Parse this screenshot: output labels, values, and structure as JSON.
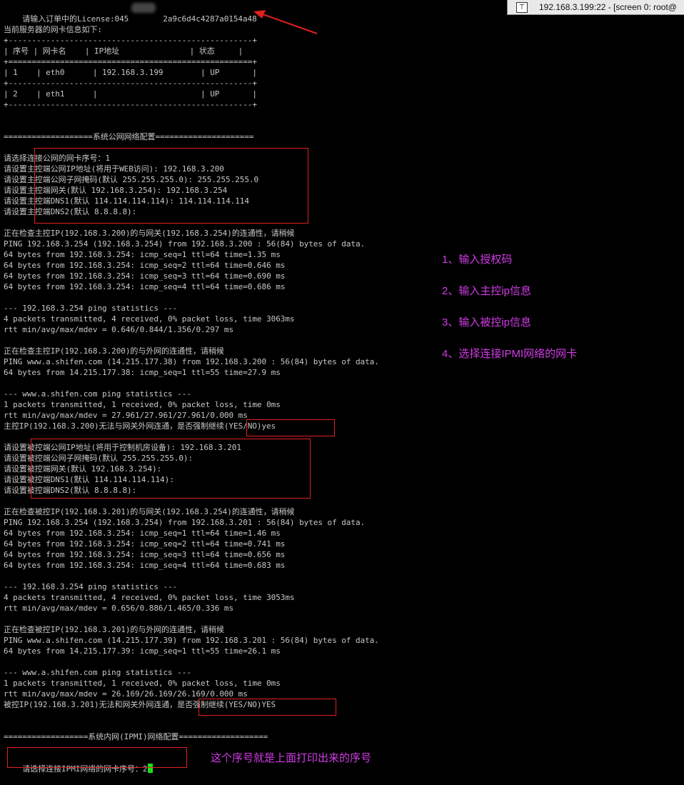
{
  "window": {
    "title": "192.168.3.199:22 - [screen 0: root@"
  },
  "terminal": {
    "license_prefix": "请输入订单中的License:045",
    "license_suffix": "2a9c6d4c4287a0154a48",
    "lines": [
      "当前服务器的网卡信息如下:",
      "+----------------------------------------------------+",
      "| 序号 | 网卡名    | IP地址               | 状态     |",
      "+====================================================+",
      "| 1    | eth0      | 192.168.3.199        | UP       |",
      "+----------------------------------------------------+",
      "| 2    | eth1      |                      | UP       |",
      "+----------------------------------------------------+",
      "===================系统公网网络配置=====================",
      "请选择连接公网的网卡序号：1",
      "请设置主控端公网IP地址(将用于WEB访问): 192.168.3.200",
      "请设置主控端公网子网掩码(默认 255.255.255.0): 255.255.255.0",
      "请设置主控端网关(默认 192.168.3.254): 192.168.3.254",
      "请设置主控端DNS1(默认 114.114.114.114): 114.114.114.114",
      "请设置主控端DNS2(默认 8.8.8.8):",
      "正在检查主控IP(192.168.3.200)的与网关(192.168.3.254)的连通性，请稍候",
      "PING 192.168.3.254 (192.168.3.254) from 192.168.3.200 : 56(84) bytes of data.",
      "64 bytes from 192.168.3.254: icmp_seq=1 ttl=64 time=1.35 ms",
      "64 bytes from 192.168.3.254: icmp_seq=2 ttl=64 time=0.646 ms",
      "64 bytes from 192.168.3.254: icmp_seq=3 ttl=64 time=0.690 ms",
      "64 bytes from 192.168.3.254: icmp_seq=4 ttl=64 time=0.686 ms",
      "--- 192.168.3.254 ping statistics ---",
      "4 packets transmitted, 4 received, 0% packet loss, time 3063ms",
      "rtt min/avg/max/mdev = 0.646/0.844/1.356/0.297 ms",
      "正在检查主控IP(192.168.3.200)的与外网的连通性，请稍候",
      "PING www.a.shifen.com (14.215.177.38) from 192.168.3.200 : 56(84) bytes of data.",
      "64 bytes from 14.215.177.38: icmp_seq=1 ttl=55 time=27.9 ms",
      "--- www.a.shifen.com ping statistics ---",
      "1 packets transmitted, 1 received, 0% packet loss, time 0ms",
      "rtt min/avg/max/mdev = 27.961/27.961/27.961/0.000 ms",
      "主控IP(192.168.3.200)无法与网关外网连通，是否强制继续(YES/NO)yes",
      "请设置被控端公网IP地址(将用于控制机房设备): 192.168.3.201",
      "请设置被控端公网子网掩码(默认 255.255.255.0):",
      "请设置被控端网关(默认 192.168.3.254):",
      "请设置被控端DNS1(默认 114.114.114.114):",
      "请设置被控端DNS2(默认 8.8.8.8):",
      "正在检查被控IP(192.168.3.201)的与网关(192.168.3.254)的连通性，请稍候",
      "PING 192.168.3.254 (192.168.3.254) from 192.168.3.201 : 56(84) bytes of data.",
      "64 bytes from 192.168.3.254: icmp_seq=1 ttl=64 time=1.46 ms",
      "64 bytes from 192.168.3.254: icmp_seq=2 ttl=64 time=0.741 ms",
      "64 bytes from 192.168.3.254: icmp_seq=3 ttl=64 time=0.656 ms",
      "64 bytes from 192.168.3.254: icmp_seq=4 ttl=64 time=0.683 ms",
      "--- 192.168.3.254 ping statistics ---",
      "4 packets transmitted, 4 received, 0% packet loss, time 3053ms",
      "rtt min/avg/max/mdev = 0.656/0.886/1.465/0.336 ms",
      "正在检查被控IP(192.168.3.201)的与外网的连通性，请稍候",
      "PING www.a.shifen.com (14.215.177.39) from 192.168.3.201 : 56(84) bytes of data.",
      "64 bytes from 14.215.177.39: icmp_seq=1 ttl=55 time=26.1 ms",
      "--- www.a.shifen.com ping statistics ---",
      "1 packets transmitted, 1 received, 0% packet loss, time 0ms",
      "rtt min/avg/max/mdev = 26.169/26.169/26.169/0.000 ms",
      "被控IP(192.168.3.201)无法和网关外网连通，是否强制继续(YES/NO)YES",
      "==================系统内网(IPMI)网络配置===================",
      "请选择连接IPMI网络的网卡序号：2"
    ]
  },
  "annotations": {
    "step1": "1、输入授权码",
    "step2": "2、输入主控ip信息",
    "step3": "3、输入被控ip信息",
    "step4": "4、选择连接IPMI网络的网卡",
    "bottom_note": "这个序号就是上面打印出来的序号"
  },
  "colors": {
    "background": "#000000",
    "text": "#c8c8c8",
    "highlight_box": "#e02020",
    "note": "#d23ce8",
    "cursor": "#18e018"
  }
}
